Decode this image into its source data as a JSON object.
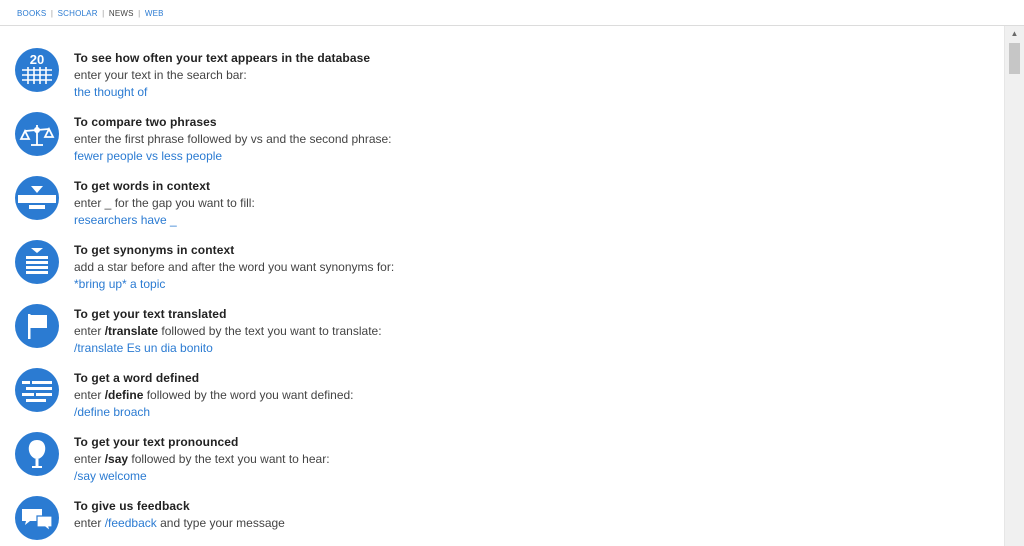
{
  "topnav": {
    "books": "BOOKS",
    "scholar": "SCHOLAR",
    "news": "NEWS",
    "web": "WEB",
    "separator": "|"
  },
  "items": [
    {
      "icon": "calendar-20-icon",
      "title": "To see how often your text appears in the database",
      "desc": "enter your text in the search bar:",
      "example": "the thought of"
    },
    {
      "icon": "scale-icon",
      "title": "To compare two phrases",
      "desc": "enter the first phrase followed by vs and the second phrase:",
      "example": "fewer people vs less people"
    },
    {
      "icon": "gap-icon",
      "title": "To get words in context",
      "desc": "enter _ for the gap you want to fill:",
      "example": "researchers have _"
    },
    {
      "icon": "synonyms-icon",
      "title": "To get synonyms in context",
      "desc": "add a star before and after the word you want synonyms for:",
      "example": "*bring up* a topic"
    },
    {
      "icon": "flag-icon",
      "title": "To get your text translated",
      "desc_pre": "enter",
      "cmd": "/translate",
      "desc_post": "followed by the text you want to translate:",
      "example": "/translate Es un dia bonito"
    },
    {
      "icon": "definition-icon",
      "title": "To get a word defined",
      "desc_pre": "enter",
      "cmd": "/define",
      "desc_post": "followed by the word you want defined:",
      "example": "/define broach"
    },
    {
      "icon": "speaker-icon",
      "title": "To get your text pronounced",
      "desc_pre": "enter",
      "cmd": "/say",
      "desc_post": "followed by the text you want to hear:",
      "example": "/say welcome"
    },
    {
      "icon": "chat-bubbles-icon",
      "title": "To give us feedback",
      "desc_pre": "enter",
      "cmd": "/feedback",
      "desc_post": "and type your message"
    }
  ],
  "icon_date_text": "20",
  "colors": {
    "accent": "#2b7bd2",
    "text": "#444444",
    "title": "#222222"
  }
}
